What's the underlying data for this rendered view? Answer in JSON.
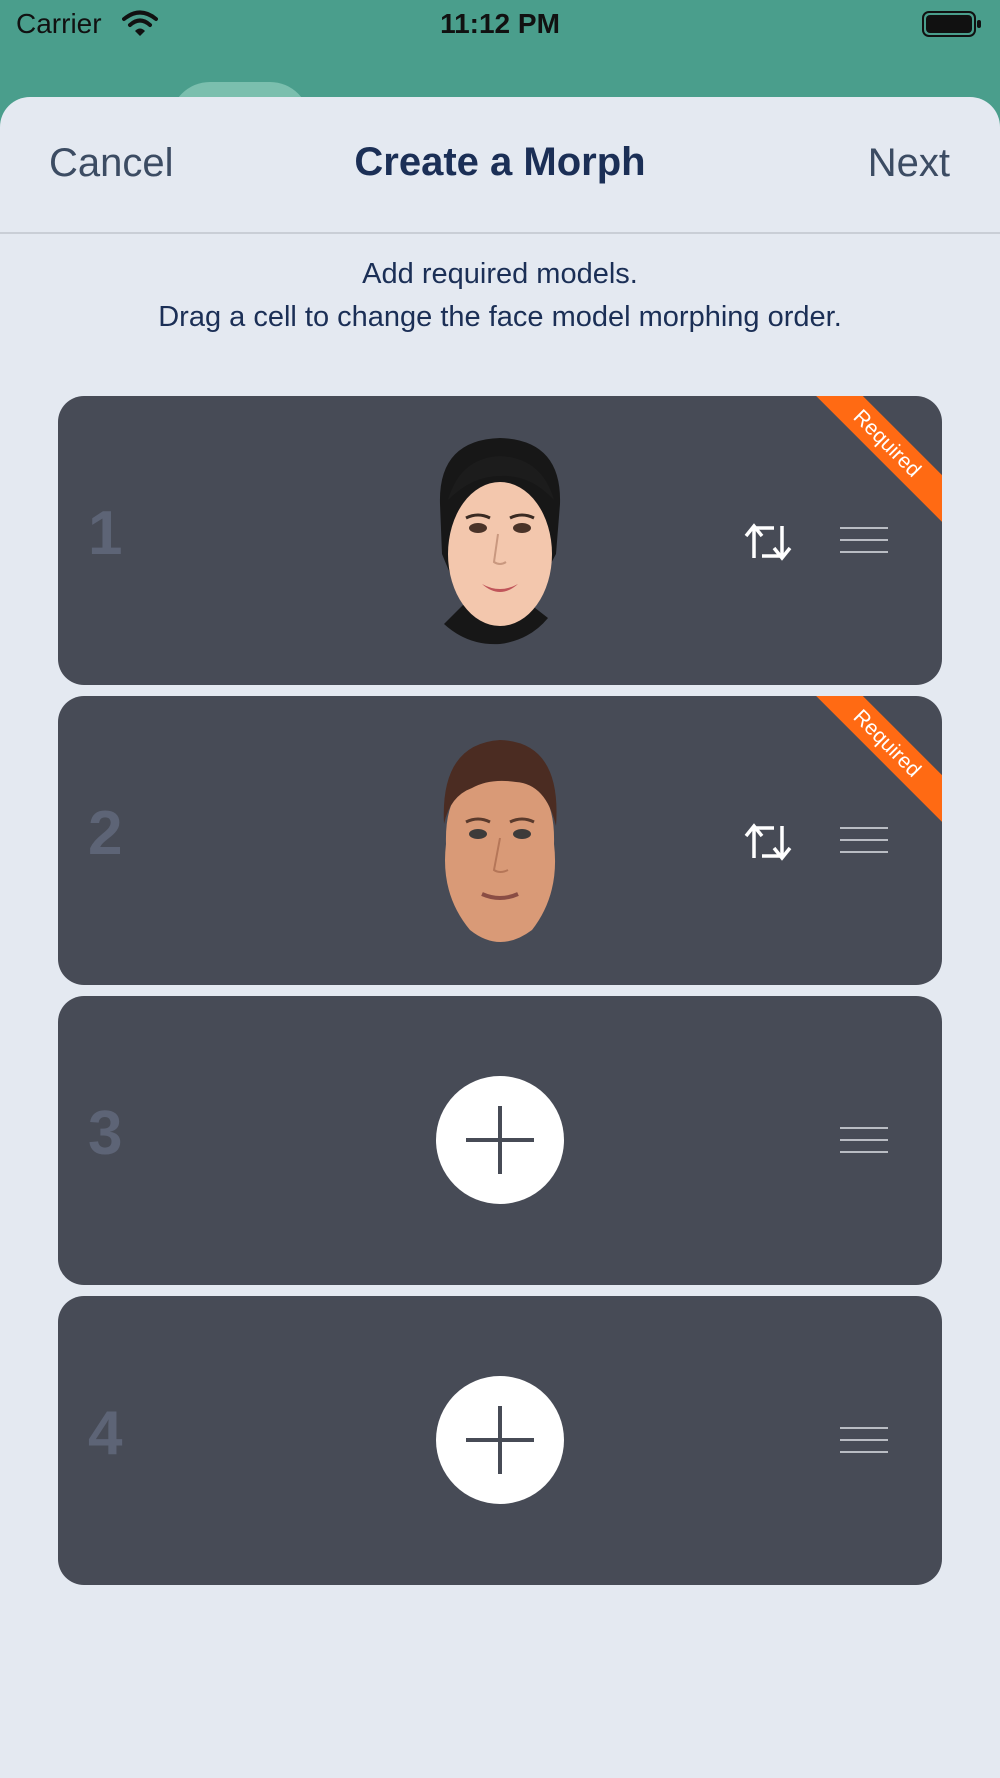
{
  "status_bar": {
    "carrier": "Carrier",
    "time": "11:12 PM"
  },
  "nav": {
    "cancel": "Cancel",
    "title": "Create a Morph",
    "next": "Next"
  },
  "instructions": {
    "line1": "Add required models.",
    "line2": "Drag a cell to change the face model morphing order."
  },
  "cells": [
    {
      "index": "1",
      "content": "face-model",
      "required_label": "Required"
    },
    {
      "index": "2",
      "content": "face-model",
      "required_label": "Required"
    },
    {
      "index": "3",
      "content": "add-button"
    },
    {
      "index": "4",
      "content": "add-button"
    }
  ],
  "colors": {
    "status_background": "#4a9e8c",
    "sheet_background": "#e4e9f1",
    "cell_background": "#474b56",
    "required_ribbon": "#ff6a13",
    "title_text": "#1b2f56"
  },
  "icons": [
    "wifi-icon",
    "battery-icon",
    "swap-icon",
    "drag-handle-icon",
    "plus-icon"
  ]
}
